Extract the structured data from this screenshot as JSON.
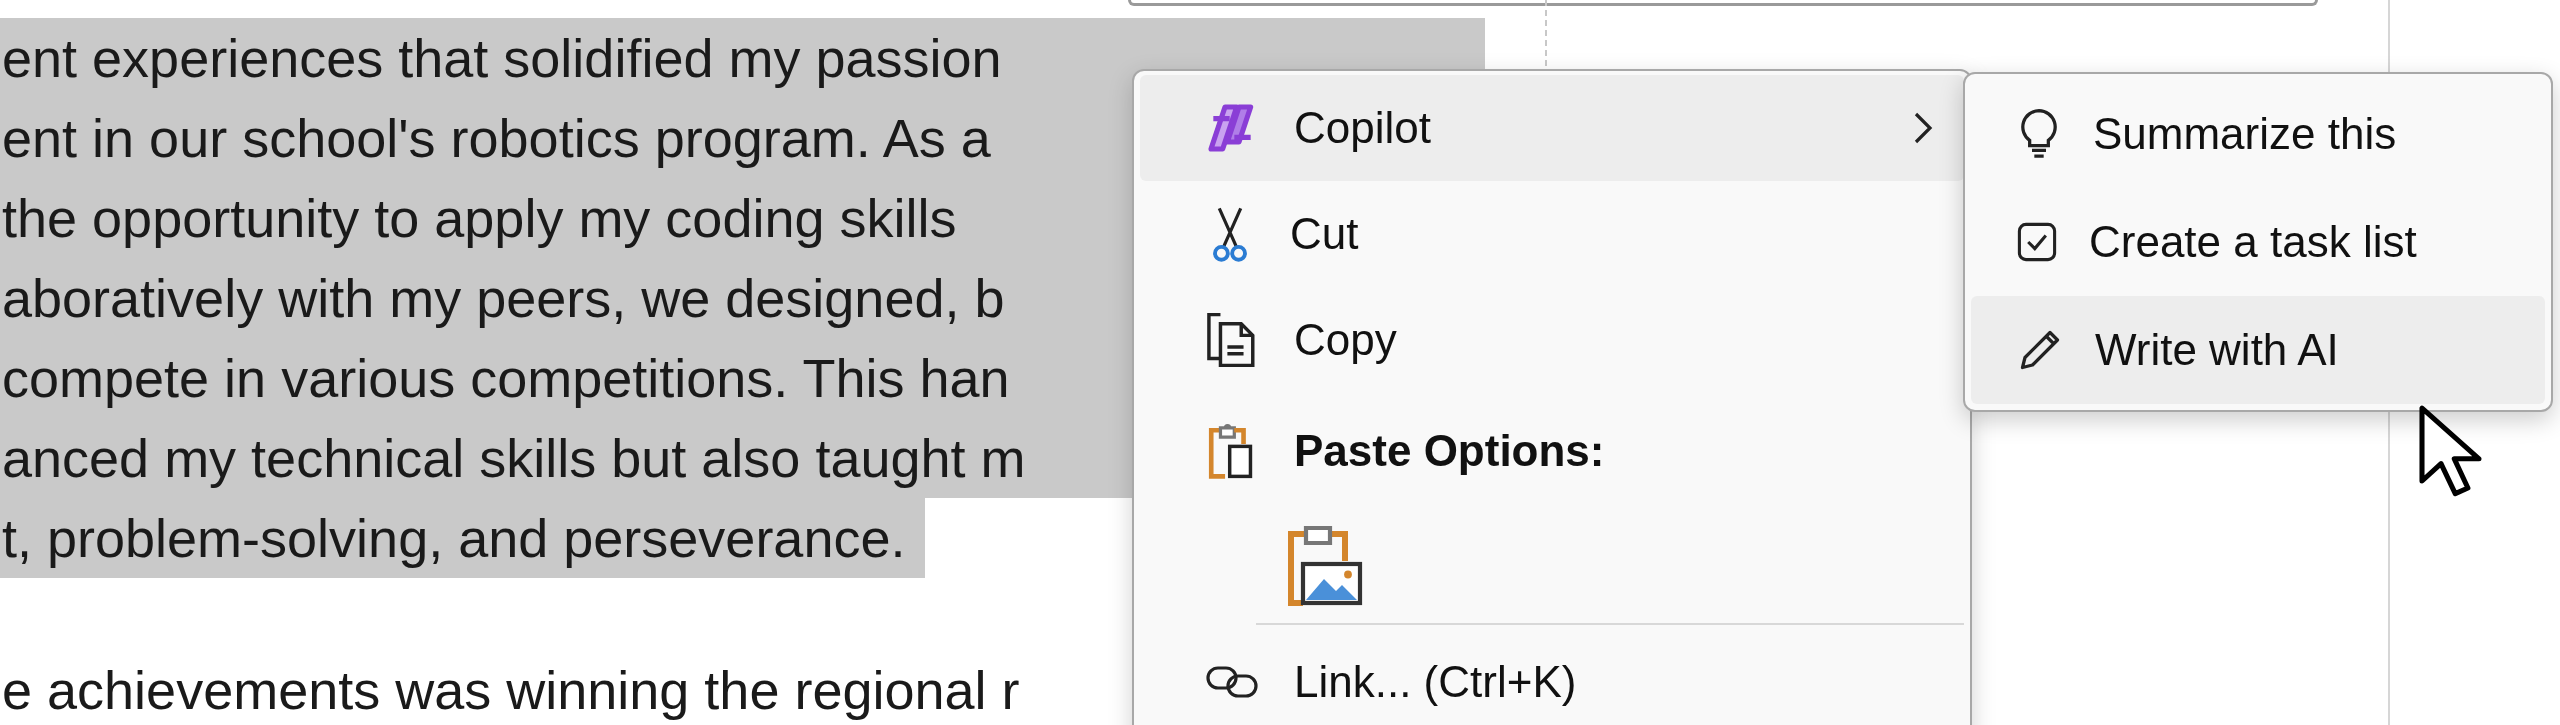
{
  "document": {
    "paragraphs": [
      {
        "selected": true,
        "lines": [
          "ent experiences that solidified my passion",
          "ent in our school's robotics program. As a",
          "the opportunity to apply my coding skills",
          "aboratively with my peers, we designed, b",
          "compete in various competitions. This han",
          "anced my technical skills but also taught m",
          "t, problem-solving, and perseverance."
        ]
      },
      {
        "selected": false,
        "lines": [
          "e achievements was winning the regional r"
        ]
      }
    ]
  },
  "context_menu": {
    "items": [
      {
        "kind": "item",
        "label": "Copilot",
        "selected": true,
        "has_submenu": true
      },
      {
        "kind": "item",
        "label": "Cut",
        "selected": false,
        "has_submenu": false
      },
      {
        "kind": "item",
        "label": "Copy",
        "selected": false,
        "has_submenu": false
      },
      {
        "kind": "heading",
        "label": "Paste Options:"
      },
      {
        "kind": "paste_option"
      },
      {
        "kind": "separator"
      },
      {
        "kind": "item",
        "label": "Link... (Ctrl+K)",
        "selected": false,
        "has_submenu": false
      }
    ]
  },
  "submenu": {
    "items": [
      {
        "label": "Summarize this",
        "selected": false
      },
      {
        "label": "Create a task list",
        "selected": false
      },
      {
        "label": "Write with AI",
        "selected": true
      }
    ]
  }
}
